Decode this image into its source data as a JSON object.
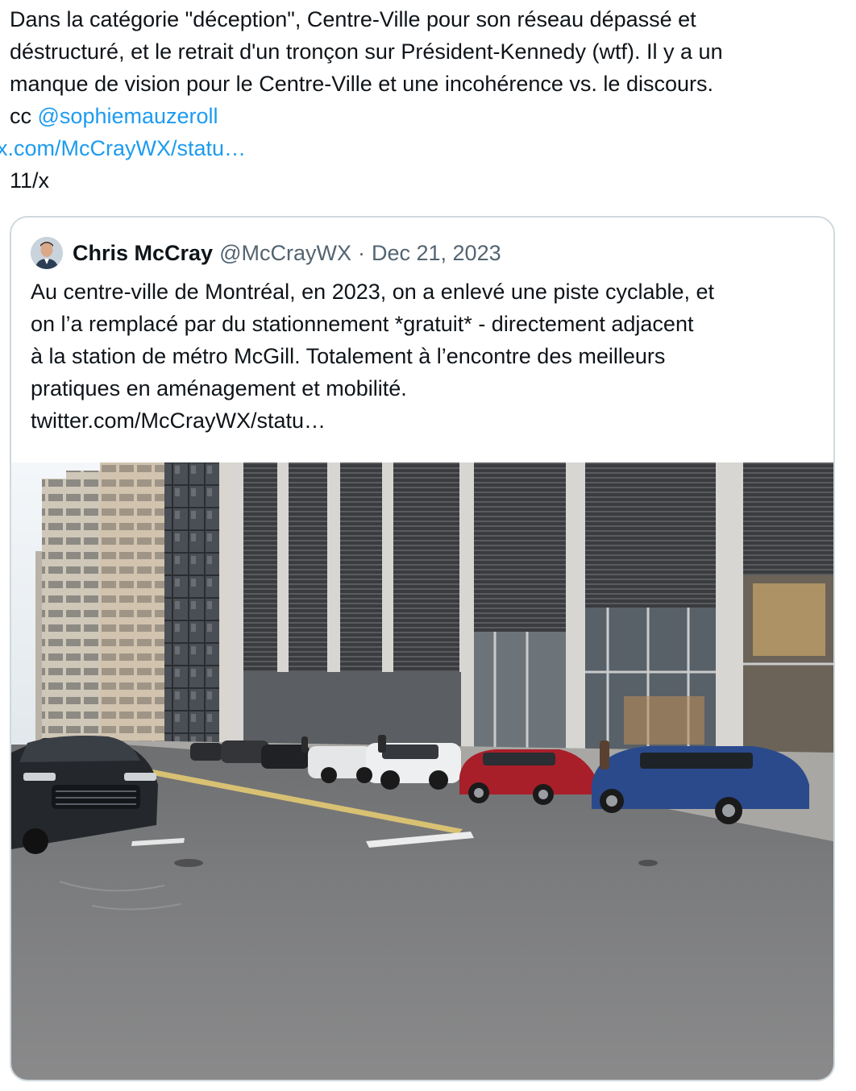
{
  "tweet": {
    "lines": [
      "Dans la catégorie \"déception\", Centre-Ville pour son réseau dépassé et",
      "déstructuré, et le retrait d'un tronçon sur Président-Kennedy (wtf). Il y a un",
      "manque de vision pour le Centre-Ville et une incohérence vs. le discours."
    ],
    "cc_prefix": "cc",
    "mention": "@sophiemauzeroll",
    "link": "x.com/McCrayWX/statu…",
    "thread_marker": "11/x"
  },
  "quote": {
    "author_name": "Chris McCray",
    "author_handle": "@McCrayWX",
    "separator": "·",
    "date": "Dec 21, 2023",
    "body_lines": [
      "Au centre-ville de Montréal, en 2023, on a enlevé une piste cyclable, et",
      "on l’a remplacé par du stationnement *gratuit* - directement adjacent",
      "à la station de métro McGill. Totalement à l’encontre des meilleurs",
      "pratiques en aménagement et mobilité."
    ],
    "link": "twitter.com/McCrayWX/statu…"
  },
  "colors": {
    "text": "#0f1419",
    "secondary": "#536471",
    "link": "#1d9bf0",
    "border": "#cfd9de"
  }
}
